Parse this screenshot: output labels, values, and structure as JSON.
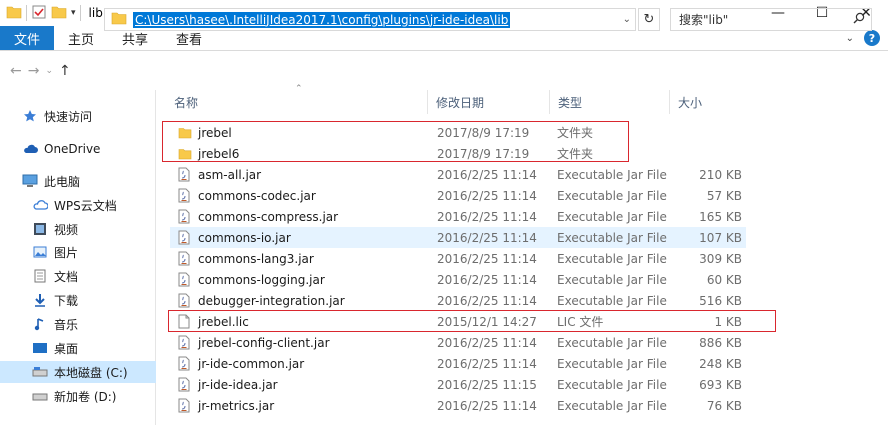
{
  "window": {
    "title": "lib",
    "controls": {
      "minimize": "—",
      "maximize": "☐",
      "close": "✕"
    }
  },
  "ribbon": {
    "file_tab": "文件",
    "tabs": [
      "主页",
      "共享",
      "查看"
    ]
  },
  "address": {
    "path": "C:\\Users\\hasee\\.IntelliJIdea2017.1\\config\\plugins\\jr-ide-idea\\lib",
    "search_placeholder": "搜索\"lib\""
  },
  "sidebar": {
    "items": [
      {
        "label": "快速访问",
        "icon": "star-icon"
      },
      {
        "label": "OneDrive",
        "icon": "cloud-icon"
      },
      {
        "label": "此电脑",
        "icon": "computer-icon"
      },
      {
        "label": "WPS云文档",
        "icon": "wps-cloud-icon"
      },
      {
        "label": "视频",
        "icon": "video-icon"
      },
      {
        "label": "图片",
        "icon": "pictures-icon"
      },
      {
        "label": "文档",
        "icon": "documents-icon"
      },
      {
        "label": "下载",
        "icon": "download-icon"
      },
      {
        "label": "音乐",
        "icon": "music-icon"
      },
      {
        "label": "桌面",
        "icon": "desktop-icon"
      },
      {
        "label": "本地磁盘 (C:)",
        "icon": "drive-icon"
      },
      {
        "label": "新加卷 (D:)",
        "icon": "drive-icon"
      }
    ]
  },
  "columns": {
    "name": "名称",
    "date": "修改日期",
    "type": "类型",
    "size": "大小"
  },
  "files": [
    {
      "name": "jrebel",
      "date": "2017/8/9 17:19",
      "type": "文件夹",
      "size": "",
      "kind": "folder"
    },
    {
      "name": "jrebel6",
      "date": "2017/8/9 17:19",
      "type": "文件夹",
      "size": "",
      "kind": "folder"
    },
    {
      "name": "asm-all.jar",
      "date": "2016/2/25 11:14",
      "type": "Executable Jar File",
      "size": "210 KB",
      "kind": "jar"
    },
    {
      "name": "commons-codec.jar",
      "date": "2016/2/25 11:14",
      "type": "Executable Jar File",
      "size": "57 KB",
      "kind": "jar"
    },
    {
      "name": "commons-compress.jar",
      "date": "2016/2/25 11:14",
      "type": "Executable Jar File",
      "size": "165 KB",
      "kind": "jar"
    },
    {
      "name": "commons-io.jar",
      "date": "2016/2/25 11:14",
      "type": "Executable Jar File",
      "size": "107 KB",
      "kind": "jar"
    },
    {
      "name": "commons-lang3.jar",
      "date": "2016/2/25 11:14",
      "type": "Executable Jar File",
      "size": "309 KB",
      "kind": "jar"
    },
    {
      "name": "commons-logging.jar",
      "date": "2016/2/25 11:14",
      "type": "Executable Jar File",
      "size": "60 KB",
      "kind": "jar"
    },
    {
      "name": "debugger-integration.jar",
      "date": "2016/2/25 11:14",
      "type": "Executable Jar File",
      "size": "516 KB",
      "kind": "jar"
    },
    {
      "name": "jrebel.lic",
      "date": "2015/12/1 14:27",
      "type": "LIC 文件",
      "size": "1 KB",
      "kind": "file"
    },
    {
      "name": "jrebel-config-client.jar",
      "date": "2016/2/25 11:14",
      "type": "Executable Jar File",
      "size": "886 KB",
      "kind": "jar"
    },
    {
      "name": "jr-ide-common.jar",
      "date": "2016/2/25 11:14",
      "type": "Executable Jar File",
      "size": "248 KB",
      "kind": "jar"
    },
    {
      "name": "jr-ide-idea.jar",
      "date": "2016/2/25 11:15",
      "type": "Executable Jar File",
      "size": "693 KB",
      "kind": "jar"
    },
    {
      "name": "jr-metrics.jar",
      "date": "2016/2/25 11:14",
      "type": "Executable Jar File",
      "size": "76 KB",
      "kind": "jar"
    }
  ],
  "colors": {
    "accent": "#1979ca",
    "selection": "#0078d7",
    "highlight_box": "#d9272e",
    "folder": "#f8c94a"
  }
}
